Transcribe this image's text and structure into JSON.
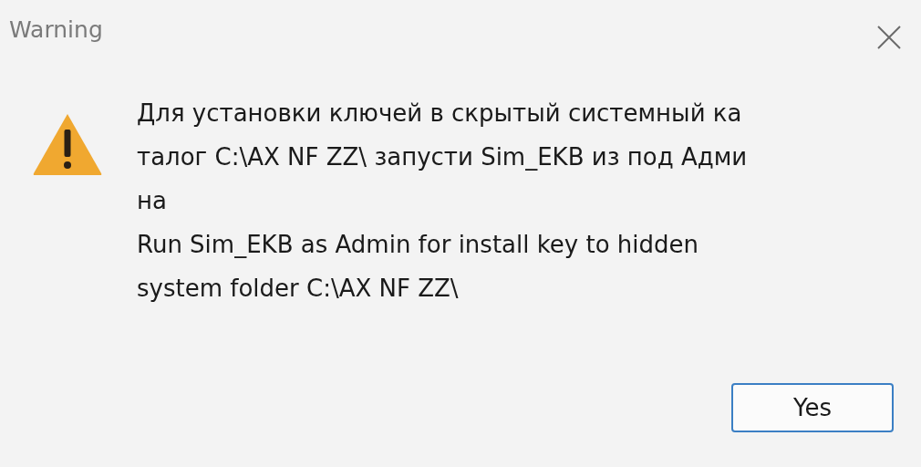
{
  "window": {
    "title": "Warning"
  },
  "message": {
    "lines": [
      "Для установки ключей в скрытый системный ка",
      "талог C:\\AX NF ZZ\\ запусти Sim_EKB из под Адми",
      "на",
      "Run Sim_EKB as Admin for install key to hidden",
      "system folder C:\\AX NF ZZ\\"
    ]
  },
  "buttons": [
    {
      "label": "Yes",
      "selected": true
    }
  ]
}
